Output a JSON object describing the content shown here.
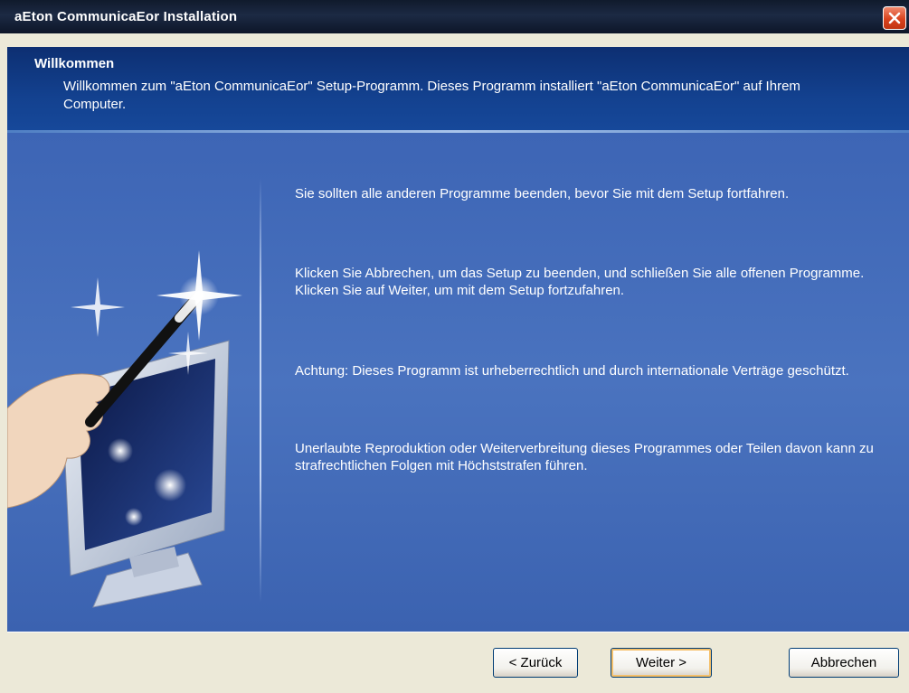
{
  "window": {
    "title": "aEton CommunicaEor Installation"
  },
  "header": {
    "title": "Willkommen",
    "text": "Willkommen zum \"aEton CommunicaEor\" Setup-Programm. Dieses Programm installiert \"aEton CommunicaEor\" auf Ihrem Computer."
  },
  "messages": [
    "Sie sollten alle anderen Programme beenden, bevor Sie mit dem Setup fortfahren.",
    "Klicken Sie  Abbrechen, um das Setup zu beenden, und schließen Sie alle offenen Programme. Klicken Sie auf  Weiter, um mit dem Setup fortzufahren.",
    "Achtung: Dieses Programm ist urheberrechtlich und durch internationale Verträge geschützt.",
    "Unerlaubte Reproduktion oder Weiterverbreitung dieses Programmes oder Teilen davon kann zu strafrechtlichen Folgen mit Höchststrafen führen."
  ],
  "buttons": {
    "back": "< Zurück",
    "next": "Weiter >",
    "cancel": "Abbrechen"
  },
  "illustration": {
    "icon": "wizard-wand-monitor-icon"
  }
}
